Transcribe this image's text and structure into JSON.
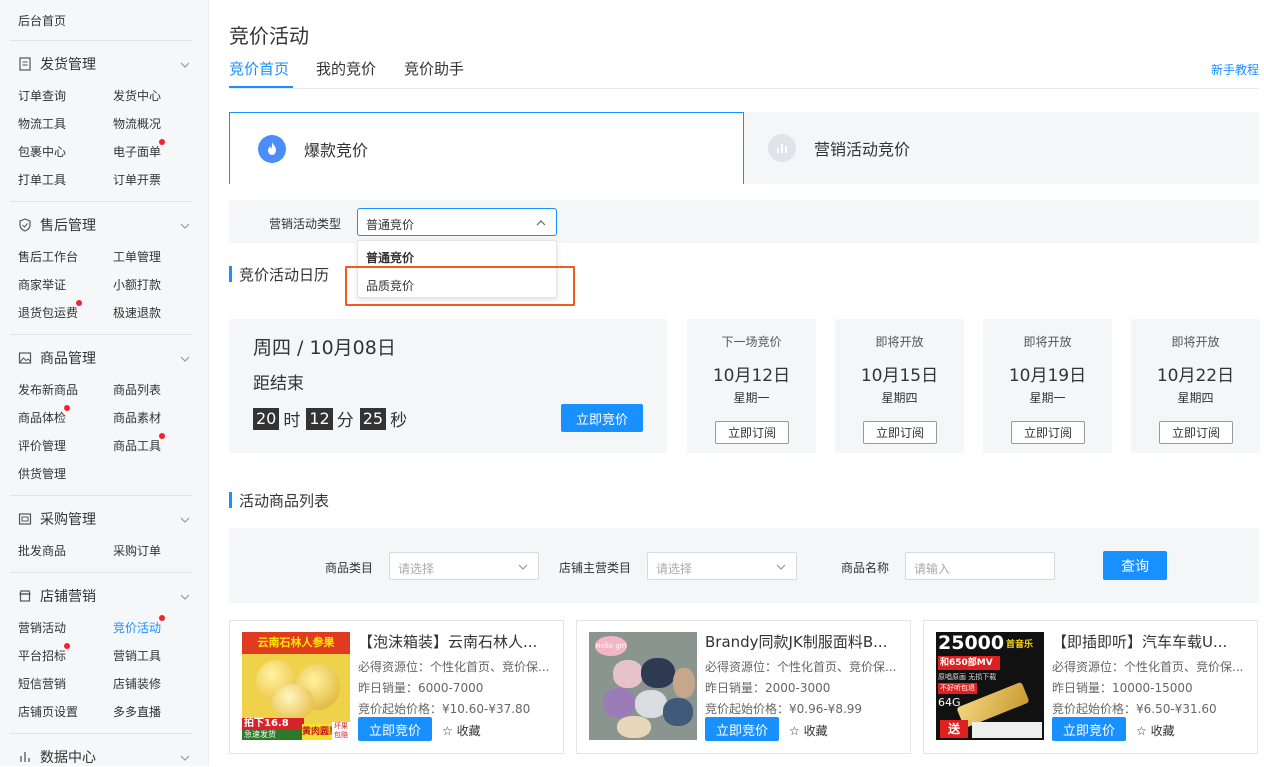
{
  "sidebar": {
    "home": "后台首页",
    "groups": [
      {
        "title": "发货管理",
        "icon": "document-icon",
        "items": [
          "订单查询",
          "发货中心",
          "物流工具",
          "物流概况",
          "包裹中心",
          "电子面单",
          "打单工具",
          "订单开票"
        ]
      },
      {
        "title": "售后管理",
        "icon": "shield-icon",
        "items": [
          "售后工作台",
          "工单管理",
          "商家举证",
          "小额打款",
          "退货包运费",
          "极速退款"
        ]
      },
      {
        "title": "商品管理",
        "icon": "image-icon",
        "items": [
          "发布新商品",
          "商品列表",
          "商品体检",
          "商品素材",
          "评价管理",
          "商品工具",
          "供货管理"
        ]
      },
      {
        "title": "采购管理",
        "icon": "cart-icon",
        "items": [
          "批发商品",
          "采购订单"
        ]
      },
      {
        "title": "店铺营销",
        "icon": "shop-icon",
        "items": [
          "营销活动",
          "竞价活动",
          "平台招标",
          "营销工具",
          "短信营销",
          "店铺装修",
          "店铺页设置",
          "多多直播"
        ]
      },
      {
        "title": "数据中心",
        "icon": "bar-chart-icon",
        "items": []
      }
    ],
    "accent": "#1890ff",
    "badge_color": "#f5222d"
  },
  "page": {
    "title": "竞价活动",
    "tabs": [
      "竞价首页",
      "我的竞价",
      "竞价助手"
    ],
    "help_link": "新手教程"
  },
  "bid_types": [
    {
      "label": "爆款竞价",
      "icon": "flame-icon"
    },
    {
      "label": "营销活动竞价",
      "icon": "chart-icon"
    }
  ],
  "filter": {
    "label": "营销活动类型",
    "value": "普通竞价",
    "options": [
      "普通竞价",
      "品质竞价"
    ]
  },
  "calendar": {
    "section_title": "竞价活动日历",
    "today": "周四 / 10月08日",
    "countdown_label": "距结束",
    "hours": "20",
    "hour_unit": "时",
    "minutes": "12",
    "minute_unit": "分",
    "seconds": "25",
    "second_unit": "秒",
    "bid_button": "立即竞价",
    "upcoming": [
      {
        "status": "下一场竞价",
        "date": "10月12日",
        "weekday": "星期一",
        "button": "立即订阅"
      },
      {
        "status": "即将开放",
        "date": "10月15日",
        "weekday": "星期四",
        "button": "立即订阅"
      },
      {
        "status": "即将开放",
        "date": "10月19日",
        "weekday": "星期一",
        "button": "立即订阅"
      },
      {
        "status": "即将开放",
        "date": "10月22日",
        "weekday": "星期四",
        "button": "立即订阅"
      }
    ]
  },
  "products_section": {
    "title": "活动商品列表",
    "category_label": "商品类目",
    "category_placeholder": "请选择",
    "store_category_label": "店铺主营类目",
    "store_category_placeholder": "请选择",
    "name_label": "商品名称",
    "name_placeholder": "请输入",
    "query_button": "查询"
  },
  "products": [
    {
      "name": "【泡沫箱装】云南石林人...",
      "resource": "必得资源位：个性化首页、竞价保...",
      "sales": "昨日销量：6000-7000",
      "price": "竞价起始价格：¥10.60-¥37.80",
      "bid": "立即竞价",
      "fav": "收藏",
      "img_top": "云南石林人参果",
      "img_mid": "拍下16.8",
      "img_sub": "急速发货",
      "img_bottom": "黄肉圆果",
      "img_corner": "坏果包赔"
    },
    {
      "name": "Brandy同款JK制服面料B...",
      "resource": "必得资源位：个性化首页、竞价保...",
      "sales": "昨日销量：2000-3000",
      "price": "竞价起始价格：¥0.96-¥8.99",
      "bid": "立即竞价",
      "fav": "收藏",
      "img_tag": "Hello girl"
    },
    {
      "name": "【即插即听】汽车车载U...",
      "resource": "必得资源位：个性化首页、竞价保...",
      "sales": "昨日销量：10000-15000",
      "price": "竞价起始价格：¥6.50-¥31.60",
      "bid": "立即竞价",
      "fav": "收藏",
      "img_big": "25000",
      "img_tag1": "首音乐",
      "img_line2": "和650部MV",
      "img_line3": "原唱原画 无损下载",
      "img_line4": "不好听包退",
      "img_size": "64G",
      "img_send": "送"
    }
  ]
}
